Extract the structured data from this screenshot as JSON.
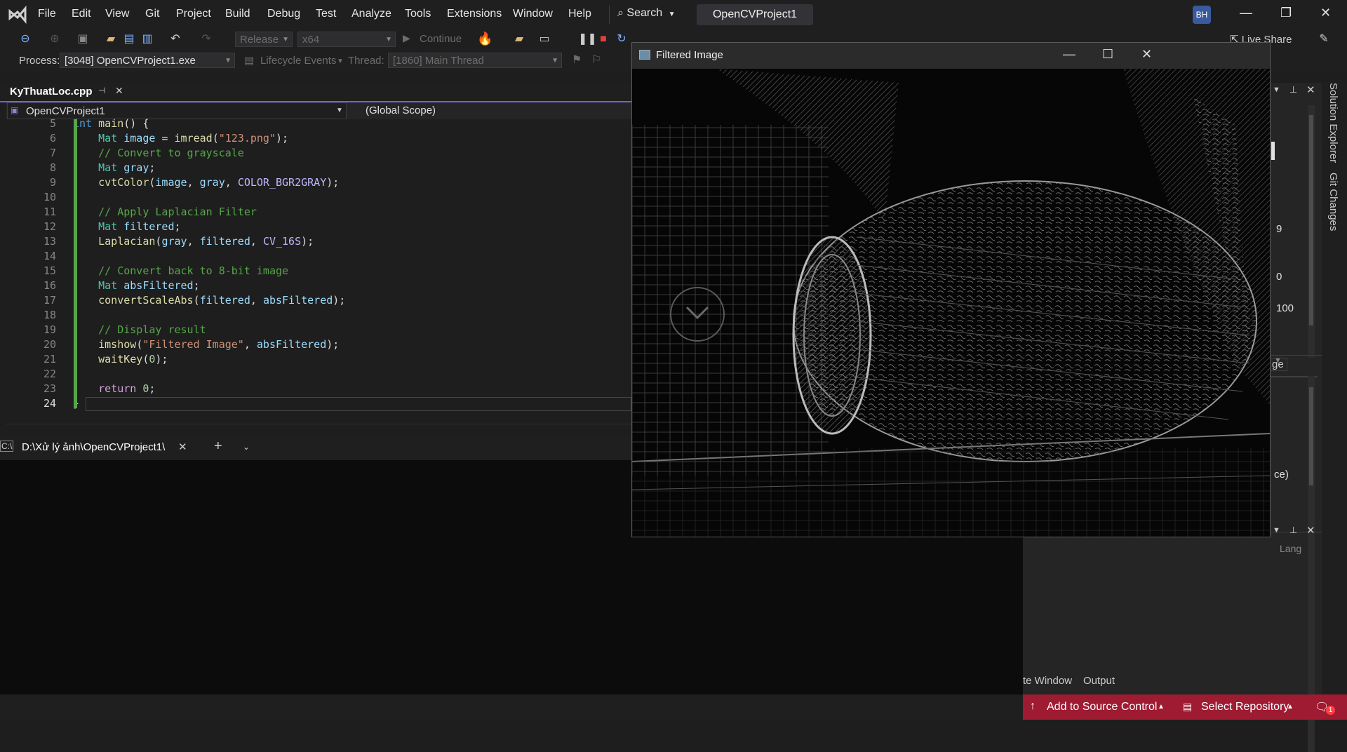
{
  "menu": {
    "items": [
      "File",
      "Edit",
      "View",
      "Git",
      "Project",
      "Build",
      "Debug",
      "Test",
      "Analyze",
      "Tools",
      "Extensions",
      "Window",
      "Help"
    ],
    "search_label": "Search",
    "project_name": "OpenCVProject1",
    "avatar_initials": "BH"
  },
  "toolbar": {
    "config": "Release",
    "platform": "x64",
    "continue_label": "Continue",
    "live_share_label": "Live Share"
  },
  "debug_bar": {
    "process_label": "Process:",
    "process_value": "[3048] OpenCVProject1.exe",
    "lifecycle_label": "Lifecycle Events",
    "thread_label": "Thread:",
    "thread_value": "[1860] Main Thread"
  },
  "editor": {
    "tab_title": "KyThuatLoc.cpp",
    "nav_project": "OpenCVProject1",
    "nav_scope": "(Global Scope)",
    "line_numbers": [
      "5",
      "6",
      "7",
      "8",
      "9",
      "10",
      "11",
      "12",
      "13",
      "14",
      "15",
      "16",
      "17",
      "18",
      "19",
      "20",
      "21",
      "22",
      "23",
      "24"
    ]
  },
  "terminal": {
    "tab_title": "D:\\Xử lý ảnh\\OpenCVProject1\\"
  },
  "image_window": {
    "title": "Filtered Image"
  },
  "right_panel": {
    "values": [
      "9",
      "0",
      "100"
    ],
    "partial_tab_1": "ge",
    "partial_text_2": "ce)",
    "partial_col_header": "Lang",
    "bottom_tabs": [
      "te Window",
      "Output"
    ]
  },
  "side_tabs": [
    "Solution Explorer",
    "Git Changes"
  ],
  "status": {
    "add_source_control": "Add to Source Control",
    "select_repository": "Select Repository",
    "notification_count": "1"
  }
}
